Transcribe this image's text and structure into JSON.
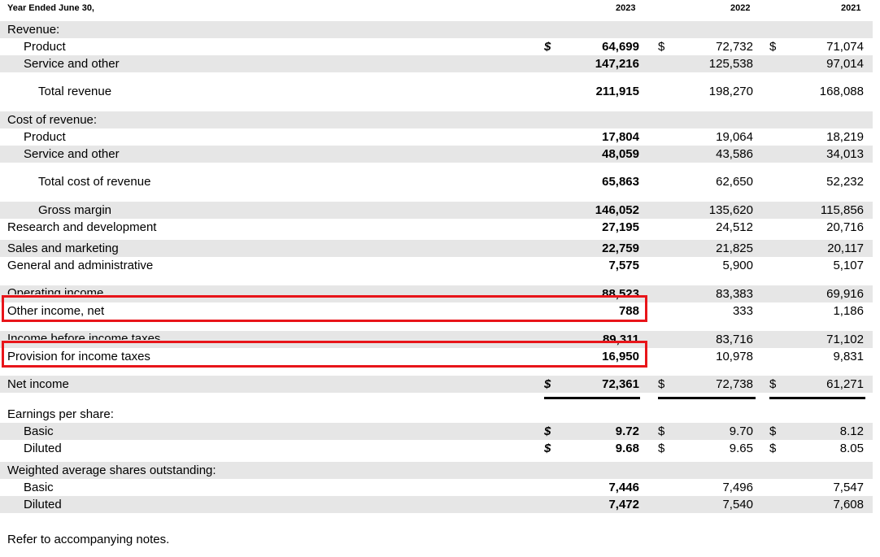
{
  "header": {
    "label": "Year Ended June 30,",
    "years": [
      "2023",
      "2022",
      "2021"
    ]
  },
  "rows": [
    {
      "label": "Revenue:",
      "indent": 0,
      "shade": true
    },
    {
      "label": "Product",
      "indent": 1,
      "shade": false,
      "v2023": "64,699",
      "v2022": "72,732",
      "v2021": "71,074",
      "dollar": true
    },
    {
      "label": "Service and other",
      "indent": 1,
      "shade": true,
      "v2023": "147,216",
      "v2022": "125,538",
      "v2021": "97,014"
    },
    {
      "label": "Total revenue",
      "indent": 2,
      "shade": false,
      "v2023": "211,915",
      "v2022": "198,270",
      "v2021": "168,088"
    },
    {
      "label": "Cost of revenue:",
      "indent": 0,
      "shade": true
    },
    {
      "label": "Product",
      "indent": 1,
      "shade": false,
      "v2023": "17,804",
      "v2022": "19,064",
      "v2021": "18,219"
    },
    {
      "label": "Service and other",
      "indent": 1,
      "shade": true,
      "v2023": "48,059",
      "v2022": "43,586",
      "v2021": "34,013"
    },
    {
      "label": "Total cost of revenue",
      "indent": 2,
      "shade": false,
      "v2023": "65,863",
      "v2022": "62,650",
      "v2021": "52,232"
    },
    {
      "label": "Gross margin",
      "indent": 2,
      "shade": true,
      "v2023": "146,052",
      "v2022": "135,620",
      "v2021": "115,856"
    },
    {
      "label": "Research and development",
      "indent": 0,
      "shade": false,
      "v2023": "27,195",
      "v2022": "24,512",
      "v2021": "20,716"
    },
    {
      "label": "Sales and marketing",
      "indent": 0,
      "shade": true,
      "v2023": "22,759",
      "v2022": "21,825",
      "v2021": "20,117"
    },
    {
      "label": "General and administrative",
      "indent": 0,
      "shade": false,
      "v2023": "7,575",
      "v2022": "5,900",
      "v2021": "5,107"
    },
    {
      "label": "Operating income",
      "indent": 0,
      "shade": true,
      "v2023": "88,523",
      "v2022": "83,383",
      "v2021": "69,916"
    },
    {
      "label": "Other income, net",
      "indent": 0,
      "shade": false,
      "v2023": "788",
      "v2022": "333",
      "v2021": "1,186"
    },
    {
      "label": "Income before income taxes",
      "indent": 0,
      "shade": true,
      "v2023": "89,311",
      "v2022": "83,716",
      "v2021": "71,102"
    },
    {
      "label": "Provision for income taxes",
      "indent": 0,
      "shade": false,
      "v2023": "16,950",
      "v2022": "10,978",
      "v2021": "9,831"
    },
    {
      "label": "Net income",
      "indent": 0,
      "shade": true,
      "v2023": "72,361",
      "v2022": "72,738",
      "v2021": "61,271",
      "dollar": true
    },
    {
      "label": "Earnings per share:",
      "indent": 0,
      "shade": false
    },
    {
      "label": "Basic",
      "indent": 1,
      "shade": true,
      "v2023": "9.72",
      "v2022": "9.70",
      "v2021": "8.12",
      "dollar": true
    },
    {
      "label": "Diluted",
      "indent": 1,
      "shade": false,
      "v2023": "9.68",
      "v2022": "9.65",
      "v2021": "8.05",
      "dollar": true
    },
    {
      "label": "Weighted average shares outstanding:",
      "indent": 0,
      "shade": true
    },
    {
      "label": "Basic",
      "indent": 1,
      "shade": false,
      "v2023": "7,446",
      "v2022": "7,496",
      "v2021": "7,547"
    },
    {
      "label": "Diluted",
      "indent": 1,
      "shade": true,
      "v2023": "7,472",
      "v2022": "7,540",
      "v2021": "7,608"
    }
  ],
  "currency_symbol": "$",
  "highlight_color": "#e8151a",
  "shade_color": "#e6e6e6",
  "footnote": "Refer to accompanying notes."
}
